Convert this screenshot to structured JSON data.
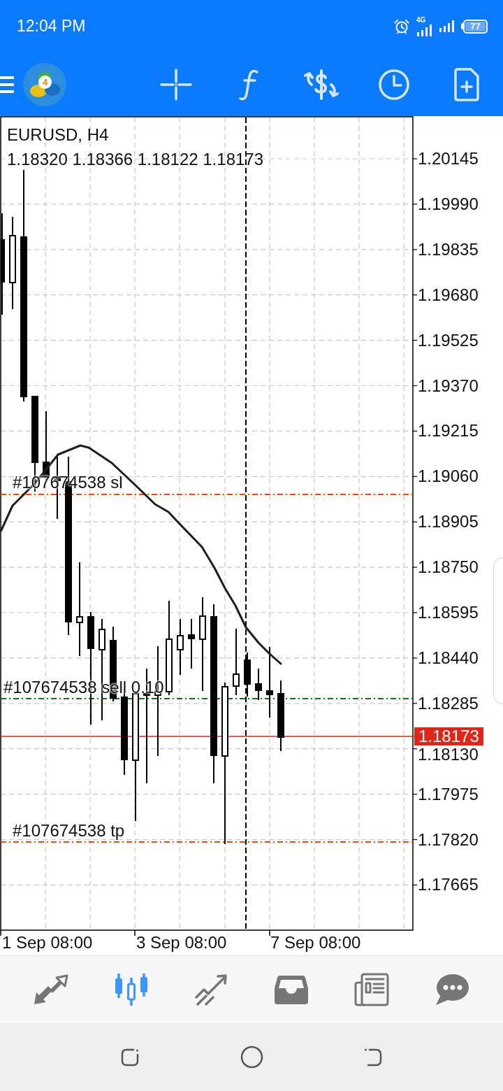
{
  "status_bar": {
    "time": "12:04 PM",
    "network": "4G",
    "battery": "77"
  },
  "toolbar": {
    "logo_badge": "4"
  },
  "chart": {
    "title": "EURUSD, H4",
    "ohlc": "1.18320 1.18366 1.18122 1.18173",
    "price_labels": [
      "1.20145",
      "1.19990",
      "1.19835",
      "1.19680",
      "1.19525",
      "1.19370",
      "1.19215",
      "1.19060",
      "1.18905",
      "1.18750",
      "1.18595",
      "1.18440",
      "1.18285",
      "1.18130",
      "1.17975",
      "1.17820",
      "1.17665"
    ],
    "order_lines": [
      {
        "label": "#107674538 sl",
        "color": "#ff4500"
      },
      {
        "label": "#107674538 sell 0.10",
        "color": "#008000"
      },
      {
        "label": "#107674538 tp",
        "color": "#ff4500"
      }
    ],
    "current_price": "1.18173",
    "time_labels": [
      "1 Sep 08:00",
      "3 Sep 08:00",
      "7 Sep 08:00"
    ]
  },
  "bottom_nav": [
    {
      "selected": false
    },
    {
      "selected": true
    },
    {
      "selected": false
    },
    {
      "selected": false
    },
    {
      "selected": false
    },
    {
      "selected": false
    }
  ]
}
